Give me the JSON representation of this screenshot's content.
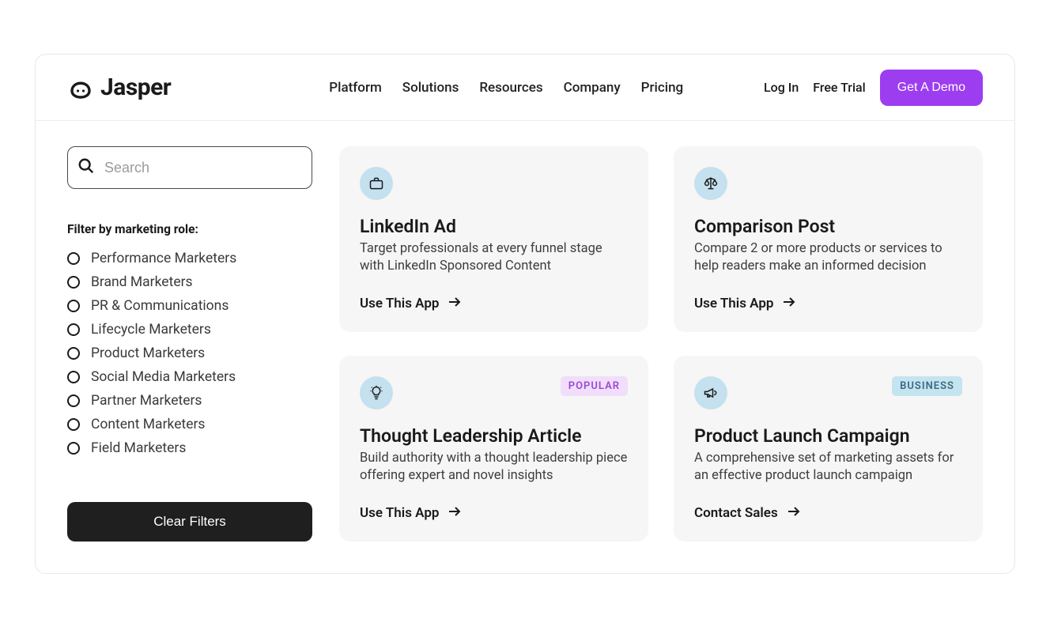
{
  "brand": {
    "name": "Jasper"
  },
  "nav": {
    "items": [
      "Platform",
      "Solutions",
      "Resources",
      "Company",
      "Pricing"
    ]
  },
  "header_actions": {
    "login": "Log In",
    "free_trial": "Free Trial",
    "demo": "Get A Demo"
  },
  "search": {
    "placeholder": "Search"
  },
  "filter": {
    "title": "Filter by marketing role:",
    "options": [
      "Performance Marketers",
      "Brand Marketers",
      "PR & Communications",
      "Lifecycle Marketers",
      "Product Marketers",
      "Social Media Marketers",
      "Partner Marketers",
      "Content Marketers",
      "Field Marketers"
    ],
    "clear_label": "Clear Filters"
  },
  "cards": [
    {
      "icon": "briefcase-icon",
      "badge": null,
      "title": "LinkedIn Ad",
      "desc": "Target professionals at every funnel stage with LinkedIn Sponsored Content",
      "cta": "Use This App"
    },
    {
      "icon": "scales-icon",
      "badge": null,
      "title": "Comparison Post",
      "desc": "Compare 2 or more products or services to help readers make an informed decision",
      "cta": "Use This App"
    },
    {
      "icon": "lightbulb-icon",
      "badge": {
        "text": "POPULAR",
        "kind": "popular"
      },
      "title": "Thought Leadership Article",
      "desc": "Build authority with a thought leadership piece offering expert and novel insights",
      "cta": "Use This App"
    },
    {
      "icon": "megaphone-icon",
      "badge": {
        "text": "BUSINESS",
        "kind": "business"
      },
      "title": "Product Launch Campaign",
      "desc": "A comprehensive set of marketing assets for an effective product launch campaign",
      "cta": "Contact Sales"
    }
  ],
  "colors": {
    "accent": "#9d3df0",
    "card_bg": "#f6f6f6",
    "icon_bg": "#c5e0ee",
    "badge_popular_bg": "#f0defa",
    "badge_popular_fg": "#9c47d6",
    "badge_business_bg": "#c4e4ef",
    "badge_business_fg": "#3b6880"
  }
}
